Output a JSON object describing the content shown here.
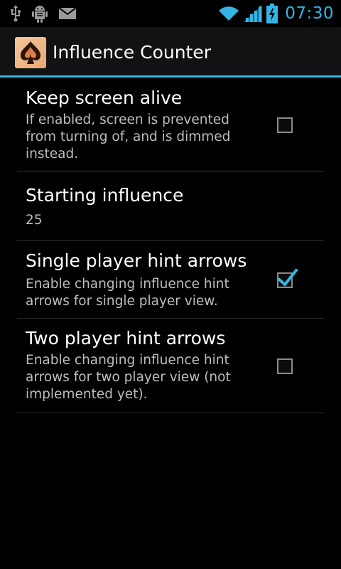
{
  "status_bar": {
    "time": "07:30",
    "icons": [
      "usb-icon",
      "android-debug-icon",
      "email-icon",
      "wifi-icon",
      "signal-icon",
      "battery-charging-icon"
    ],
    "accent_color": "#33b5e5"
  },
  "action_bar": {
    "title": "Influence Counter",
    "icon": "spade-app-icon",
    "divider_color": "#33b5e5"
  },
  "preferences": [
    {
      "title": "Keep screen alive",
      "summary": "If enabled, screen is prevented from turning of, and is dimmed instead.",
      "widget": "checkbox",
      "checked": false
    },
    {
      "title": "Starting influence",
      "summary": "25",
      "widget": "none"
    },
    {
      "title": "Single player hint arrows",
      "summary": "Enable changing influence hint arrows for single player view.",
      "widget": "checkbox",
      "checked": true
    },
    {
      "title": "Two player hint arrows",
      "summary": "Enable changing influence hint arrows for two player view (not implemented yet).",
      "widget": "checkbox",
      "checked": false
    }
  ]
}
